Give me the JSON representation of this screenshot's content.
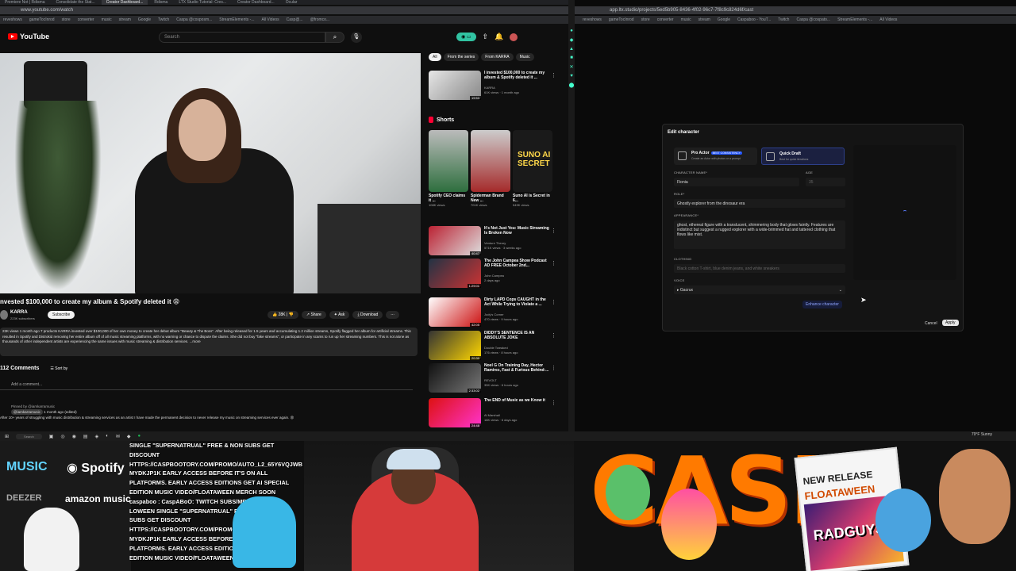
{
  "left_browser": {
    "tabs": [
      "Premiere Not | Rdisma",
      "Consolidate the Stat...",
      "Creator Dashboard...",
      "Rdisma",
      "LTX Studio Tutorial: Cres...",
      "Creator Dashboard...",
      "Ocular"
    ],
    "address": "www.youtube.com/watch",
    "bookmarks": [
      "reveshows",
      "gameTocInrod",
      "store",
      "converter",
      "music",
      "stream",
      "Google",
      "Twitch",
      "Caspa @cosposm...",
      "StreamElements -...",
      "All Videos",
      "Casp@...",
      "@fromco..."
    ]
  },
  "youtube": {
    "logo": "YouTube",
    "search_placeholder": "Search",
    "video_title": "nvested $100,000 to create my album & Spotify deleted it 😩",
    "channel": {
      "name": "KARRA",
      "subs": "223K subscribers",
      "subscribe_label": "Subscribe"
    },
    "actions": {
      "likes": "28K",
      "share": "Share",
      "ask": "Ask",
      "download": "Download",
      "more": "⋯"
    },
    "description": "22K views  1 month ago  7 products\nKARRA invested over $100,000 of her own money to create her debut album \"Beauty & The Boss\". After being released for 1.5 years and accumulating 1.2 million streams, Spotify flagged her album for artificial streams. This resulted in Spotify and Distrokid removing her entire album off of all music streaming platforms, with no warning or chance to dispute the claims. She did not buy \"fake streams\", or participate in any scams to run up her streaming numbers. This is not alone as thousands of other independent artists are experiencing the same issues with music streaming & distribution services. ...more",
    "comments_count": "112 Comments",
    "sort_by": "Sort by",
    "add_comment": "Add a comment...",
    "comment": {
      "pinned": "Pinned by @iamkarramusic",
      "handle": "@iamkarramusic",
      "time": "1 month ago (edited)",
      "text": "After 10+ years of struggling with music distribution & streaming services as an artist I have made the permanent decision to never release my music on streaming services ever again. 😩"
    },
    "chips": [
      "All",
      "From the series",
      "From KARRA",
      "Music"
    ],
    "recs_top": [
      {
        "title": "I invested $100,000 to create my album & Spotify deleted it ...",
        "channel": "KARRA",
        "meta": "61K views · 1 month ago",
        "duration": "19:53"
      }
    ],
    "shorts_label": "Shorts",
    "shorts": [
      {
        "title": "Spotify CEO claims it ...",
        "views": "108K views"
      },
      {
        "title": "Spiderman Brand New ...",
        "views": "701K views"
      },
      {
        "title": "Suno AI is Secret in 6...",
        "views": "549K views"
      }
    ],
    "recs": [
      {
        "title": "It's Not Just You: Music Streaming Is Broken Now",
        "channel": "Venture Theory",
        "meta": "571K views · 3 weeks ago",
        "duration": "40:47"
      },
      {
        "title": "The John Campea Show Podcast AD FREE October 2nd...",
        "channel": "John Campea",
        "meta": "2 days ago",
        "duration": "1:29:01"
      },
      {
        "title": "Dirty LAPD Cops CAUGHT in the Act While Trying to Violate a ...",
        "channel": "Jody's Corner",
        "meta": "470 views · 9 hours ago",
        "duration": "42:05"
      },
      {
        "title": "DIDDY'S SENTENCE IS AN ABSOLUTE JOKE",
        "channel": "Double Tweaked",
        "meta": "176 views · 8 hours ago",
        "duration": "20:30"
      },
      {
        "title": "Noel G On Training Day, Hector Ramirez, Fast & Furious Behind-...",
        "channel": "REVOLT",
        "meta": "35K views · 6 hours ago",
        "duration": "2:33:02"
      },
      {
        "title": "The END of Music as we Know it",
        "channel": "Al Marshall",
        "meta": "18K views · 6 days ago",
        "duration": "24:48"
      }
    ]
  },
  "right_browser": {
    "address": "app.ltx.studio/projects/5ed5b905-8436-4f02-96c7-7f8c9c824d6f/cast",
    "bookmarks": [
      "reveshows",
      "gameTocInrod",
      "store",
      "converter",
      "music",
      "stream",
      "Google",
      "Caspaboo - YouT...",
      "Twitch",
      "Caspa @cospato...",
      "StreamElements -...",
      "All Videos"
    ]
  },
  "modal": {
    "title": "Edit character",
    "option_pro": {
      "title": "Pro Actor",
      "badge": "BEST CONSISTENCY",
      "subtitle": "Create an Actor with photos or a prompt"
    },
    "option_quick": {
      "title": "Quick Draft",
      "subtitle": "Best for quick iterations"
    },
    "character_name_label": "CHARACTER NAME*",
    "character_name": "Fionia",
    "age_label": "AGE",
    "age": "35",
    "role_label": "ROLE*",
    "role": "Ghostly explorer from the dinosaur era",
    "appearance_label": "APPEARANCE*",
    "appearance": "ghost, ethereal figure with a translucent, shimmering body that glows faintly. Features are indistinct but suggest a rugged explorer with a wide-brimmed hat and tattered clothing that flows like mist.",
    "clothing_label": "CLOTHING",
    "clothing_placeholder": "Black cotton T-shirt, blue denim jeans, and white sneakers",
    "voice_label": "VOICE",
    "voice": "Gacrux",
    "enhance_label": "Enhance character",
    "cancel_label": "Cancel",
    "apply_label": "Apply"
  },
  "taskbar": {
    "search": "Search",
    "weather": "79°F Sunny"
  },
  "stream": {
    "brands": [
      "MUSIC",
      "Spotify",
      "DEEZER",
      "amazon music"
    ],
    "ticker": [
      "SINGLE \"SUPERNATRUAL\" FREE & NON SUBS GET",
      "DISCOUNT",
      "HTTPS://CASPBOOTORY.COM/PROMO/AUTO_L2_65Y6VQJWB",
      "MYDKJP1K EARLY ACCESS BEFORE IT'S ON ALL",
      "PLATFORMS. EARLY ACCESS EDITIONS GET AI SPECIAL",
      "EDITION MUSIC VIDEO/FLOATAWEEN MERCH SOON",
      "caspaboo : CaspABoO: TWITCH SUBS/MEMBERS",
      "LOWEEN SINGLE \"SUPERNATRUAL\" FREE & NON",
      "SUBS GET DISCOUNT",
      "HTTPS://CASPBOOTORY.COM/PROMO/AUTO_L2_",
      "MYDKJP1K EARLY ACCESS BEFORE IT'S ON ALL",
      "PLATFORMS. EARLY ACCESS EDITIONS GET AI",
      "EDITION MUSIC VIDEO/FLOATAWEEN MERCH SOON"
    ],
    "art_text": "CASP",
    "release_card": {
      "top": "NEW RELEASE",
      "title": "FLOATAWEEN",
      "art_text": "RADGUYS"
    }
  }
}
